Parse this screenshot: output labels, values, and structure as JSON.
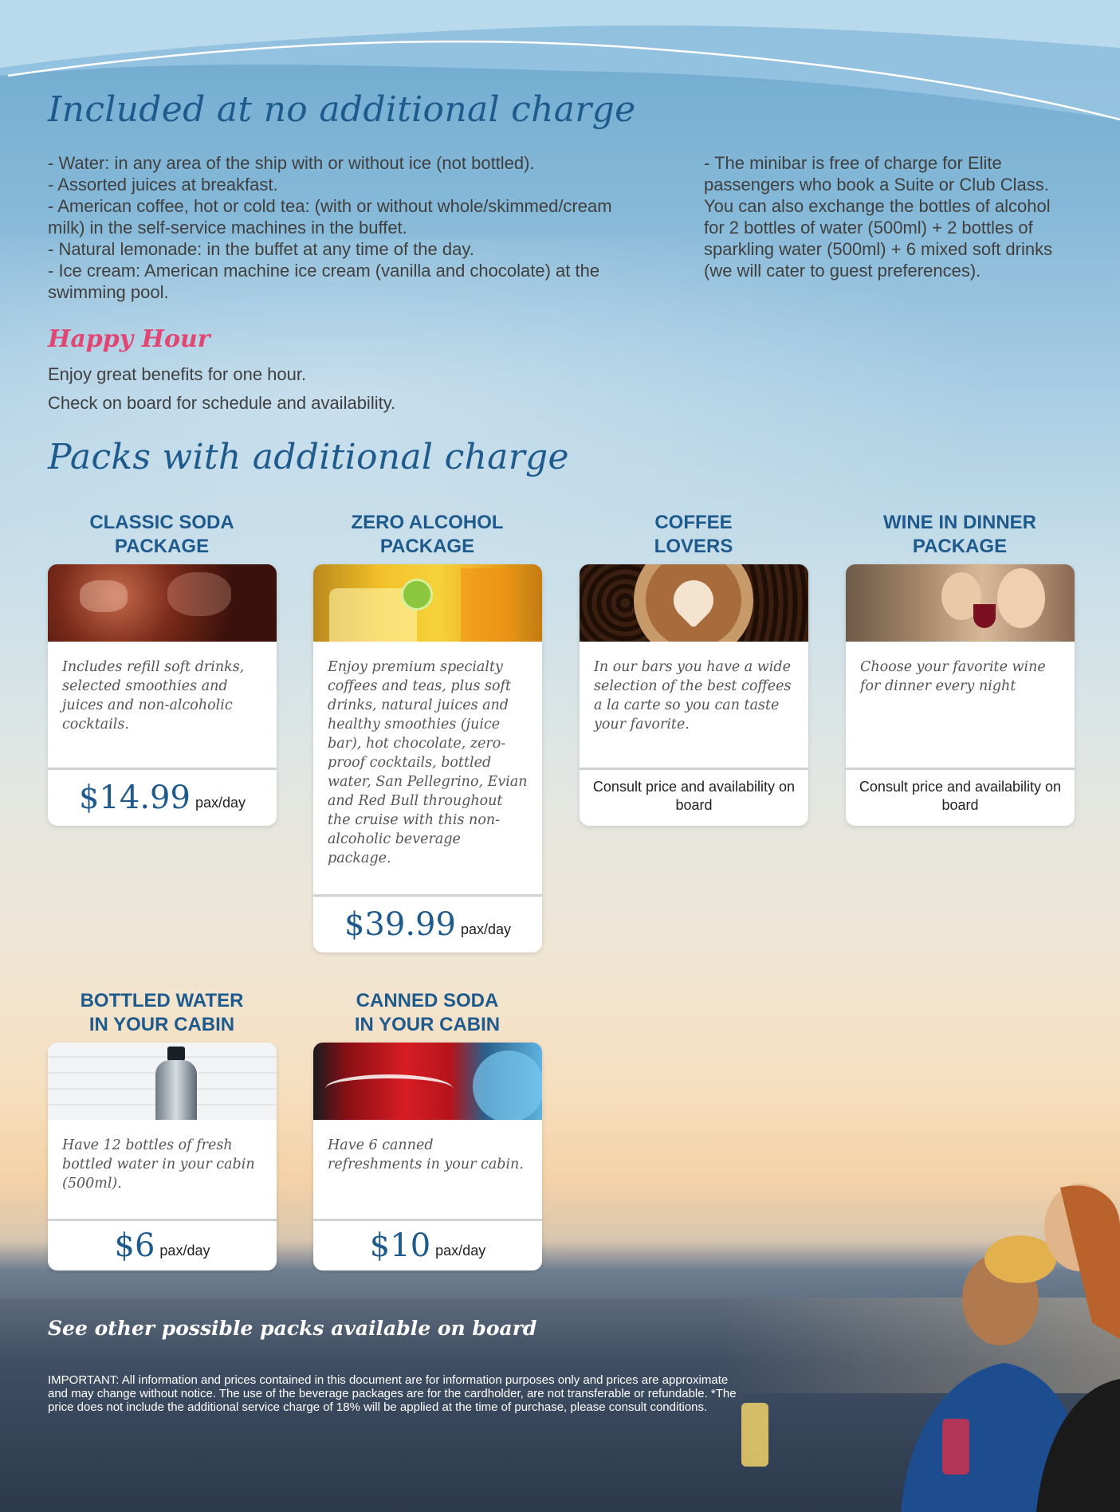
{
  "included": {
    "title": "Included at no additional charge",
    "left_items": [
      "- Water: in any area of the ship with or without ice (not bottled).",
      "- Assorted juices at breakfast.",
      "- American coffee, hot or cold tea: (with or without whole/skimmed/cream milk) in the self-service machines in the buffet.",
      "- Natural lemonade: in the buffet at any time of the day.",
      "- Ice cream: American machine ice cream (vanilla and chocolate) at the swimming pool."
    ],
    "right_text": "- The minibar is free of charge for Elite passengers who book a Suite or Club Class. You can also exchange the bottles of alcohol for 2 bottles of water (500ml) + 2 bottles of sparkling water (500ml) + 6 mixed soft drinks (we will cater to guest preferences)."
  },
  "happy_hour": {
    "title": "Happy Hour",
    "line1": "Enjoy great benefits for one hour.",
    "line2": "Check on board for schedule and availability."
  },
  "packs": {
    "title": "Packs with additional charge",
    "items": [
      {
        "title_l1": "CLASSIC SODA",
        "title_l2": "PACKAGE",
        "image": "ice-cola-image",
        "desc": "Includes refill soft drinks, selected smoothies and juices and non-alcoholic cocktails.",
        "price": "$14.99",
        "per": "pax/day"
      },
      {
        "title_l1": "ZERO ALCOHOL",
        "title_l2": "PACKAGE",
        "image": "juice-cocktail-image",
        "desc": "Enjoy premium specialty coffees and teas, plus soft drinks, natural juices and healthy smoothies (juice bar), hot chocolate, zero-proof cocktails, bottled water, San Pellegrino, Evian and Red Bull throughout the cruise with this non-alcoholic beverage package.",
        "price": "$39.99",
        "per": "pax/day"
      },
      {
        "title_l1": "COFFEE",
        "title_l2": "LOVERS",
        "image": "latte-art-image",
        "desc": "In our bars you have a wide selection of the best coffees a la carte so you can taste your favorite.",
        "consult": "Consult price and availability on board"
      },
      {
        "title_l1": "WINE IN DINNER",
        "title_l2": "PACKAGE",
        "image": "wine-glass-image",
        "desc": "Choose your favorite wine for dinner every night",
        "consult": "Consult price and availability on board"
      },
      {
        "title_l1": "BOTTLED WATER",
        "title_l2": "IN YOUR CABIN",
        "image": "water-bottle-image",
        "desc": "Have 12 bottles of fresh bottled water in your cabin (500ml).",
        "price": "$6",
        "per": "pax/day"
      },
      {
        "title_l1": "CANNED SODA",
        "title_l2": "IN YOUR CABIN",
        "image": "soda-can-image",
        "desc": "Have 6 canned refreshments in your cabin.",
        "price": "$10",
        "per": "pax/day"
      }
    ]
  },
  "footer": {
    "heading": "See other possible packs available on board",
    "note": "IMPORTANT: All information and prices contained in this document are for information purposes only and prices are approximate and may change without notice. The use of the beverage packages are for the cardholder, are not transferable or refundable. *The price does not include the additional service charge of 18% will be applied at the time of purchase, please consult conditions."
  },
  "colors": {
    "heading_blue": "#1f5a8c",
    "happy_pink": "#e24673"
  }
}
